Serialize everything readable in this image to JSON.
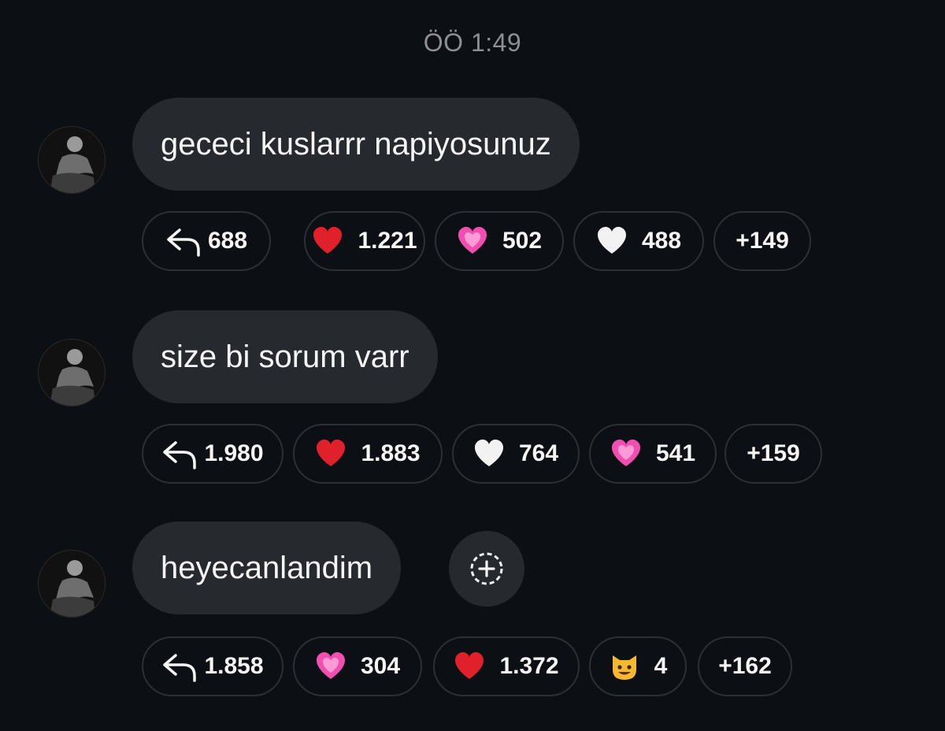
{
  "timestamp": "ÖÖ 1:49",
  "messages": [
    {
      "text": "gececi kuslarrr napiyosunuz",
      "reactions": [
        {
          "icon": "reply-icon",
          "count": "688"
        },
        {
          "icon": "red-heart-icon",
          "count": "1.221"
        },
        {
          "icon": "pink-heart-icon",
          "count": "502"
        },
        {
          "icon": "white-heart-icon",
          "count": "488"
        },
        {
          "icon": "more",
          "count": "+149"
        }
      ]
    },
    {
      "text": "size bi sorum varr",
      "reactions": [
        {
          "icon": "reply-icon",
          "count": "1.980"
        },
        {
          "icon": "red-heart-icon",
          "count": "1.883"
        },
        {
          "icon": "white-heart-icon",
          "count": "764"
        },
        {
          "icon": "pink-heart-icon",
          "count": "541"
        },
        {
          "icon": "more",
          "count": "+159"
        }
      ]
    },
    {
      "text": "heyecanlandim",
      "reactions": [
        {
          "icon": "reply-icon",
          "count": "1.858"
        },
        {
          "icon": "pink-heart-icon",
          "count": "304"
        },
        {
          "icon": "red-heart-icon",
          "count": "1.372"
        },
        {
          "icon": "cat-emoji-icon",
          "count": "4"
        },
        {
          "icon": "more",
          "count": "+162"
        }
      ]
    }
  ],
  "colors": {
    "background": "#0c1014",
    "bubble": "#262a2f",
    "chip_border": "#2c3036",
    "timestamp": "#8e8e93",
    "text": "#f5f5f5"
  }
}
